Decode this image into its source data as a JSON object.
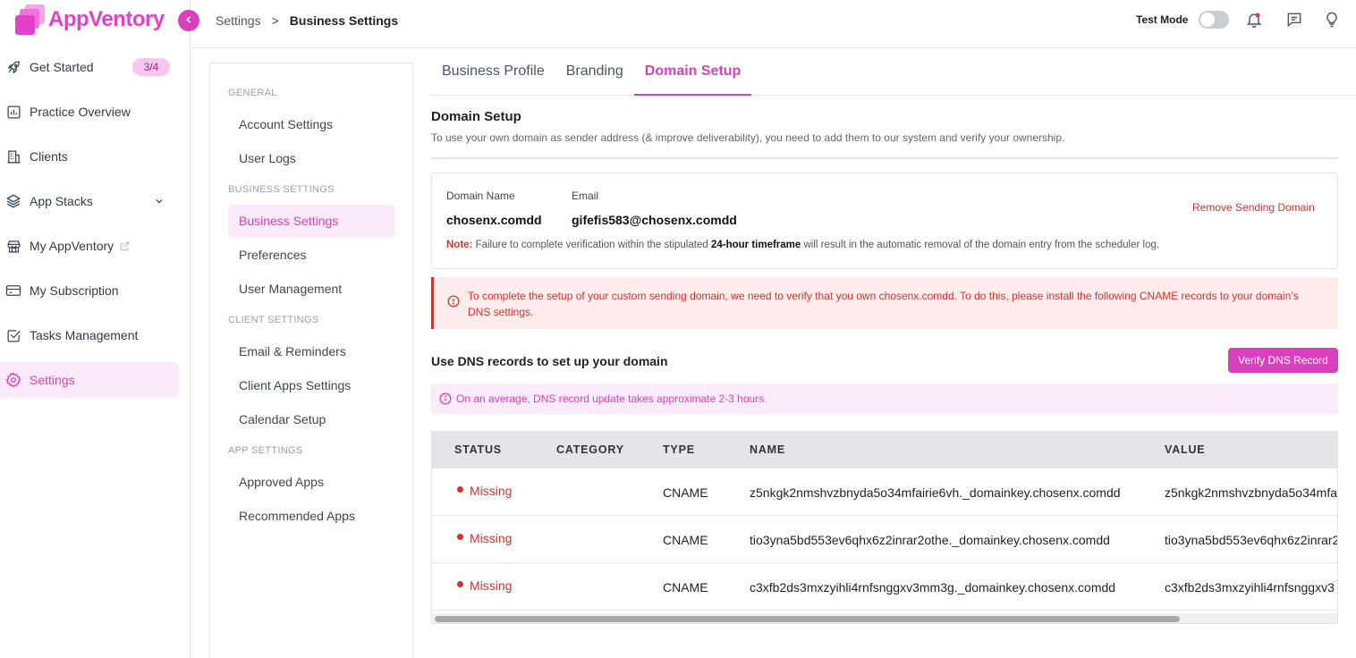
{
  "app": {
    "name": "AppVentory"
  },
  "sidebar": {
    "items": [
      {
        "label": "Get Started",
        "badge": "3/4",
        "icon": "rocket-icon"
      },
      {
        "label": "Practice Overview",
        "icon": "chart-icon"
      },
      {
        "label": "Clients",
        "icon": "building-icon"
      },
      {
        "label": "App Stacks",
        "icon": "layers-icon"
      },
      {
        "label": "My AppVentory",
        "icon": "store-icon"
      },
      {
        "label": "My Subscription",
        "icon": "card-icon"
      },
      {
        "label": "Tasks Management",
        "icon": "checkbox-icon"
      },
      {
        "label": "Settings",
        "icon": "gear-icon",
        "active": true
      }
    ]
  },
  "header": {
    "breadcrumb": [
      "Settings",
      "Business Settings"
    ],
    "breadcrumb_sep": ">",
    "test_mode_label": "Test Mode",
    "test_mode_on": false
  },
  "settings_nav": {
    "sections": [
      {
        "title": "GENERAL",
        "items": [
          "Account Settings",
          "User Logs"
        ]
      },
      {
        "title": "BUSINESS SETTINGS",
        "items": [
          "Business Settings",
          "Preferences",
          "User Management"
        ]
      },
      {
        "title": "CLIENT SETTINGS",
        "items": [
          "Email & Reminders",
          "Client Apps Settings",
          "Calendar Setup"
        ]
      },
      {
        "title": "APP SETTINGS",
        "items": [
          "Approved Apps",
          "Recommended Apps"
        ]
      }
    ],
    "active": "Business Settings"
  },
  "tabs": [
    "Business Profile",
    "Branding",
    "Domain Setup"
  ],
  "active_tab": "Domain Setup",
  "domain_setup": {
    "title": "Domain Setup",
    "description": "To use your own domain as sender address (& improve deliverability), you need to add them to our system and verify your ownership.",
    "domain_name_label": "Domain Name",
    "domain_name": "chosenx.comdd",
    "email_label": "Email",
    "email": "gifefis583@chosenx.comdd",
    "remove_label": "Remove Sending Domain",
    "note_prefix": "Note:",
    "note_text_1": " Failure to complete verification within the stipulated ",
    "note_bold": "24-hour timeframe",
    "note_text_2": " will result in the automatic removal of the domain entry from the scheduler log.",
    "alert_text": "To complete the setup of your custom sending domain, we need to verify that you own chosenx.comdd. To do this, please install the following CNAME records to your domain’s DNS settings.",
    "dns_title": "Use DNS records to set up your domain",
    "verify_button": "Verify DNS Record",
    "info_text": "On an average, DNS record update takes approximate 2-3 hours.",
    "table": {
      "columns": [
        "STATUS",
        "CATEGORY",
        "TYPE",
        "NAME",
        "VALUE"
      ],
      "rows": [
        {
          "status": "Missing",
          "category": "",
          "type": "CNAME",
          "name": "z5nkgk2nmshvzbnyda5o34mfairie6vh._domainkey.chosenx.comdd",
          "value": "z5nkgk2nmshvzbnyda5o34mfa"
        },
        {
          "status": "Missing",
          "category": "",
          "type": "CNAME",
          "name": "tio3yna5bd553ev6qhx6z2inrar2othe._domainkey.chosenx.comdd",
          "value": "tio3yna5bd553ev6qhx6z2inrar2"
        },
        {
          "status": "Missing",
          "category": "",
          "type": "CNAME",
          "name": "c3xfb2ds3mxzyihli4rnfsnggxv3mm3g._domainkey.chosenx.comdd",
          "value": "c3xfb2ds3mxzyihli4rnfsnggxv3"
        }
      ]
    }
  },
  "colors": {
    "accent": "#d940bd",
    "danger": "#d0342c",
    "accent_light": "#fce9f9"
  }
}
